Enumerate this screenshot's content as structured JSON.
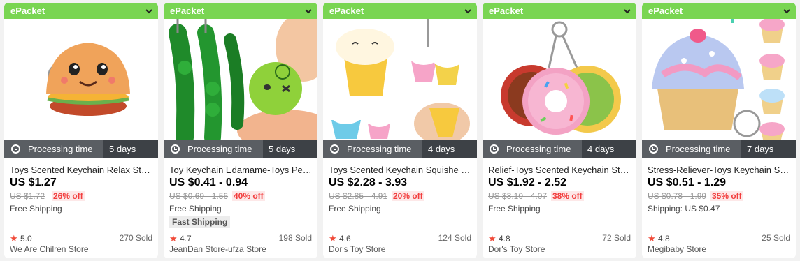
{
  "cards": [
    {
      "badge": "ePacket",
      "processing_label": "Processing time",
      "processing_days": "5 days",
      "title": "Toys Scented Keychain Relax Stress Reliever",
      "price": "US $1.27",
      "original_price": "US $1.72",
      "discount": "26% off",
      "shipping": "Free Shipping",
      "rating": "5.0",
      "sold": "270 Sold",
      "store": "We Are Chilren Store",
      "image_icon": "burger-squishy-keychain-image"
    },
    {
      "badge": "ePacket",
      "processing_label": "Processing time",
      "processing_days": "5 days",
      "title": "Toy Keychain Edamame-Toys Peas Squeeze",
      "price": "US $0.41 - 0.94",
      "original_price": "US $0.69 - 1.56",
      "discount": "40% off",
      "shipping": "Free Shipping",
      "fast_shipping": "Fast Shipping",
      "rating": "4.7",
      "sold": "198 Sold",
      "store": "JeanDan Store-ufza Store",
      "image_icon": "edamame-keychain-image"
    },
    {
      "badge": "ePacket",
      "processing_label": "Processing time",
      "processing_days": "4 days",
      "title": "Toys Scented Keychain Squishe Straps",
      "price": "US $2.28 - 3.93",
      "original_price": "US $2.85 - 4.91",
      "discount": "20% off",
      "shipping": "Free Shipping",
      "rating": "4.6",
      "sold": "124 Sold",
      "store": "Dor's Toy Store",
      "image_icon": "ice-cream-squishy-image"
    },
    {
      "badge": "ePacket",
      "processing_label": "Processing time",
      "processing_days": "4 days",
      "title": "Relief-Toys Scented Keychain Stress Relief",
      "price": "US $1.92 - 2.52",
      "original_price": "US $3.10 - 4.07",
      "discount": "38% off",
      "shipping": "Free Shipping",
      "rating": "4.8",
      "sold": "72 Sold",
      "store": "Dor's Toy Store",
      "image_icon": "donut-keychain-image"
    },
    {
      "badge": "ePacket",
      "processing_label": "Processing time",
      "processing_days": "7 days",
      "title": "Stress-Reliever-Toys Keychain Scented Cupcake",
      "price": "US $0.51 - 1.29",
      "original_price": "US $0.78 - 1.99",
      "discount": "35% off",
      "shipping": "Shipping: US $0.47",
      "rating": "4.8",
      "sold": "25 Sold",
      "store": "Megibaby Store",
      "image_icon": "cupcake-keychain-image"
    }
  ],
  "colors": {
    "badge_green": "#79d552",
    "processing_bar": "#5a5e63",
    "days_bar": "#3d4146",
    "discount_red": "#f23d3d",
    "star_red": "#f04b3a"
  }
}
